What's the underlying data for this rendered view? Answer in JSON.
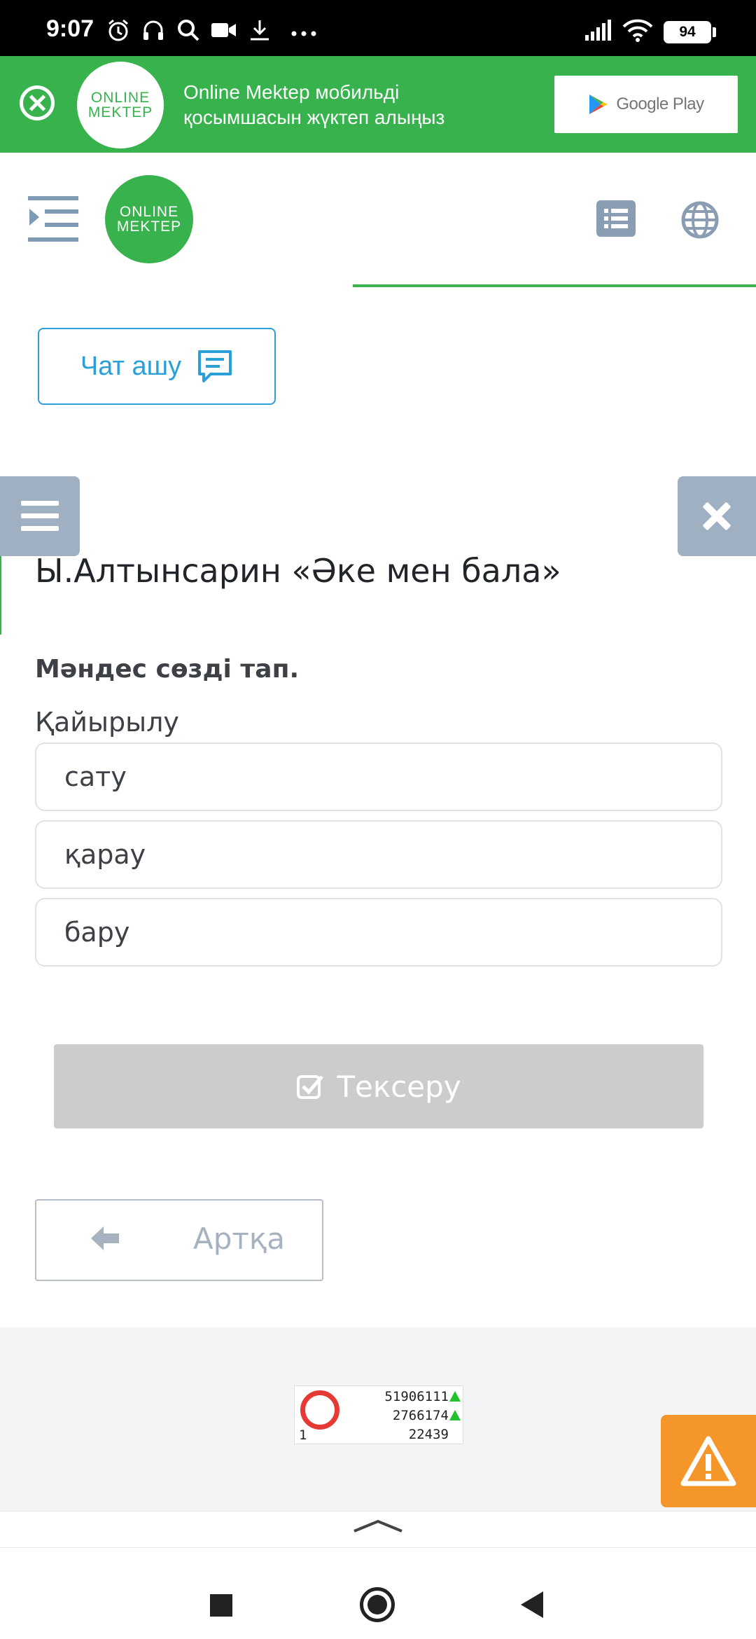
{
  "status_bar": {
    "time": "9:07",
    "battery": "94",
    "icons": [
      "alarm-icon",
      "headset-icon",
      "search-icon",
      "video-icon",
      "download-icon",
      "more-dots-icon",
      "signal-icon",
      "wifi-icon",
      "battery-icon"
    ]
  },
  "banner": {
    "logo_line1": "ONLINE",
    "logo_line2": "MEKTEP",
    "text_line1": "Online Mektep мобильді",
    "text_line2": "қосымшасын жүктеп алыңыз",
    "store_label": "Google Play",
    "accent_color": "#37b24d"
  },
  "header": {
    "logo_line1": "ONLINE",
    "logo_line2": "MEKTEP"
  },
  "chat": {
    "label": "Чат ашу",
    "color": "#2a9fd8"
  },
  "lesson": {
    "title": "Ы.Алтынсарин «Әке мен бала»"
  },
  "task": {
    "heading": "Мәндес сөзді тап.",
    "word": "Қайырылу",
    "options": [
      "сату",
      "қарау",
      "бару"
    ]
  },
  "actions": {
    "check_label": "Тексеру",
    "back_label": "Артқа"
  },
  "counter": {
    "total": "51906111",
    "month": "2766174",
    "today": "22439",
    "online": "1"
  },
  "colors": {
    "warning": "#f5962b",
    "side_button": "#9eb0c2",
    "disabled_button": "#cccccc"
  }
}
